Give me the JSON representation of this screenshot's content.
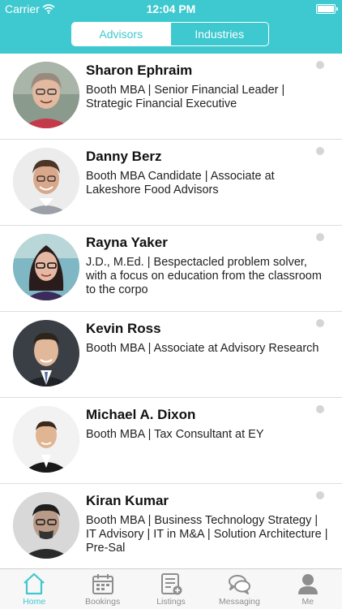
{
  "status": {
    "carrier": "Carrier",
    "time": "12:04 PM"
  },
  "segments": {
    "advisors": "Advisors",
    "industries": "Industries",
    "selected": "Advisors"
  },
  "advisors": [
    {
      "name": "Sharon Ephraim",
      "desc": "Booth MBA | Senior Financial Leader | Strategic Financial Executive"
    },
    {
      "name": "Danny Berz",
      "desc": "Booth MBA Candidate  | Associate at Lakeshore Food Advisors"
    },
    {
      "name": "Rayna Yaker",
      "desc": "J.D., M.Ed. | Bespectacled problem solver, with a focus on education from the classroom to the corpo"
    },
    {
      "name": "Kevin Ross",
      "desc": "Booth MBA | Associate at Advisory Research"
    },
    {
      "name": "Michael A. Dixon",
      "desc": "Booth MBA | Tax Consultant at EY"
    },
    {
      "name": "Kiran Kumar",
      "desc": "Booth MBA | Business Technology Strategy | IT Advisory | IT in M&A | Solution Architecture | Pre-Sal"
    }
  ],
  "tabs": [
    {
      "label": "Home",
      "icon": "home-icon",
      "active": true
    },
    {
      "label": "Bookings",
      "icon": "calendar-icon",
      "active": false
    },
    {
      "label": "Listings",
      "icon": "listings-icon",
      "active": false
    },
    {
      "label": "Messaging",
      "icon": "chat-icon",
      "active": false
    },
    {
      "label": "Me",
      "icon": "person-icon",
      "active": false
    }
  ],
  "colors": {
    "accent": "#3ec8cf",
    "tab_inactive": "#8e8e8e",
    "divider": "#dddddd"
  }
}
